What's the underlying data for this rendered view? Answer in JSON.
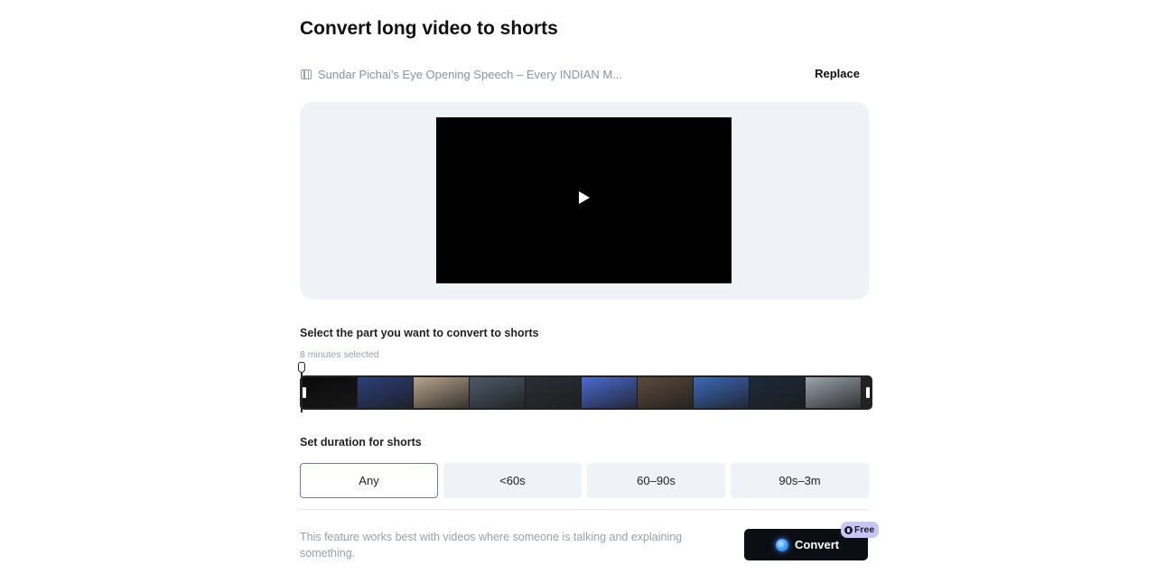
{
  "page": {
    "title": "Convert long video to shorts"
  },
  "file": {
    "icon": "film-icon",
    "name": "Sundar Pichai's Eye Opening Speech – Every INDIAN M...",
    "replace_label": "Replace"
  },
  "preview": {
    "play_icon": "play-icon"
  },
  "selection": {
    "label": "Select the part you want to convert to shorts",
    "sublabel": "8 minutes selected",
    "frames": [
      {
        "bg": "#0a0a0a"
      },
      {
        "bg": "#2b3f7a"
      },
      {
        "bg": "#b8a58c"
      },
      {
        "bg": "#4d5a68"
      },
      {
        "bg": "#2a2f36"
      },
      {
        "bg": "#4a6ad1"
      },
      {
        "bg": "#5b4a3c"
      },
      {
        "bg": "#3b69b8"
      },
      {
        "bg": "#1c2a3a"
      },
      {
        "bg": "#9aa3ad"
      }
    ]
  },
  "duration": {
    "label": "Set duration for shorts",
    "options": [
      "Any",
      "<60s",
      "60–90s",
      "90s–3m"
    ],
    "selected": "Any"
  },
  "footer": {
    "hint": "This feature works best with videos where someone is talking and explaining something.",
    "convert_label": "Convert",
    "badge_label": "Free"
  },
  "colors": {
    "accent": "#6d72e3",
    "button_dark": "#0b0f14",
    "badge": "#c9c4f4",
    "panel": "#eff2f6"
  }
}
